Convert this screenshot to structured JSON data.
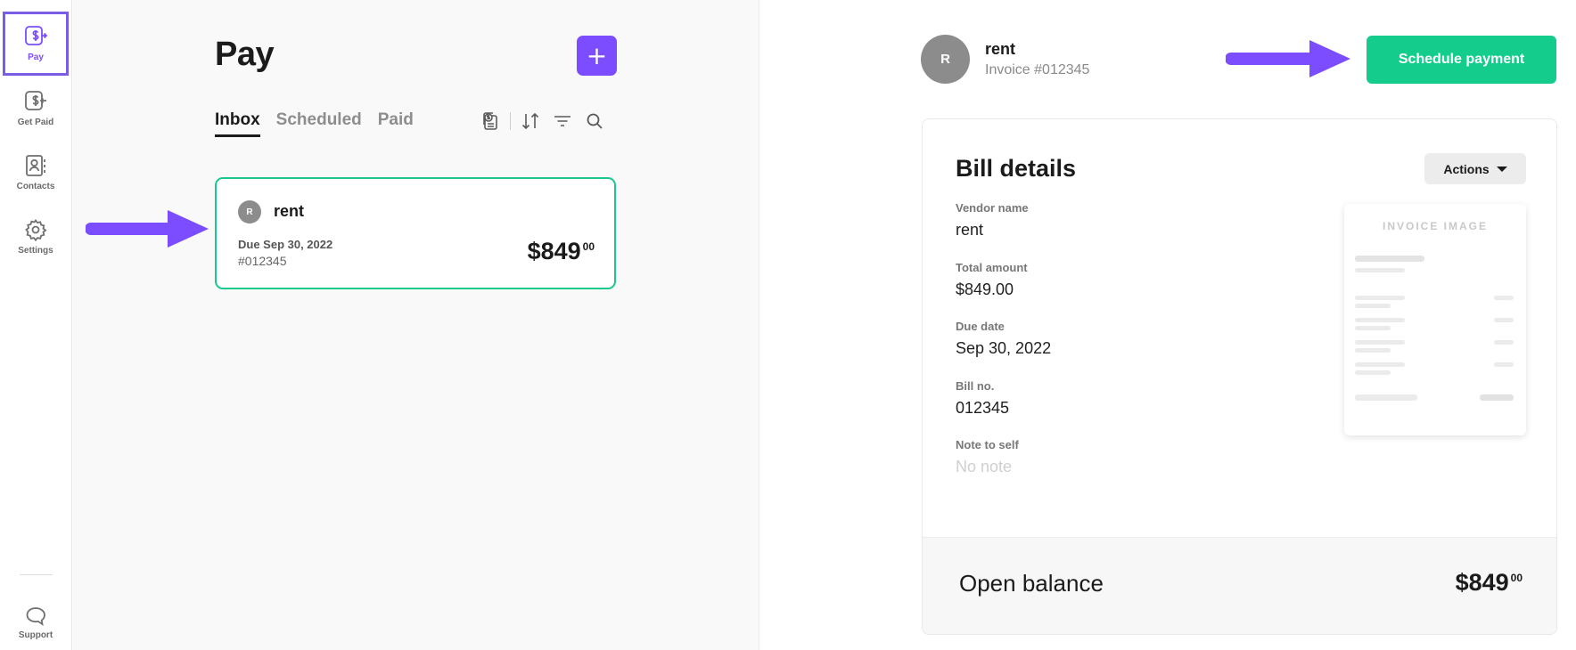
{
  "sidebar": {
    "items": [
      {
        "label": "Pay",
        "icon": "pay-icon",
        "active": true
      },
      {
        "label": "Get Paid",
        "icon": "get-paid-icon"
      },
      {
        "label": "Contacts",
        "icon": "contacts-icon"
      },
      {
        "label": "Settings",
        "icon": "gear-icon"
      }
    ],
    "support": {
      "label": "Support",
      "icon": "chat-bubble-icon"
    }
  },
  "pay": {
    "title": "Pay",
    "add_label": "+",
    "tabs": [
      {
        "label": "Inbox",
        "active": true
      },
      {
        "label": "Scheduled"
      },
      {
        "label": "Paid"
      }
    ],
    "tools": [
      "upload-bill-icon",
      "sort-icon",
      "filter-icon",
      "search-icon"
    ],
    "bills": [
      {
        "avatar": "R",
        "vendor": "rent",
        "due": "Due Sep 30, 2022",
        "number": "#012345",
        "amount": "$849",
        "cents": "00"
      }
    ]
  },
  "detail": {
    "avatar": "R",
    "vendor": "rent",
    "invoice": "Invoice #012345",
    "schedule_label": "Schedule payment",
    "card_title": "Bill details",
    "actions_label": "Actions",
    "fields": [
      {
        "label": "Vendor name",
        "value": "rent"
      },
      {
        "label": "Total amount",
        "value": "$849.00"
      },
      {
        "label": "Due date",
        "value": "Sep 30, 2022"
      },
      {
        "label": "Bill no.",
        "value": "012345"
      },
      {
        "label": "Note to self",
        "value": "No note"
      }
    ],
    "invoice_image_label": "INVOICE IMAGE",
    "balance_label": "Open balance",
    "balance_amount": "$849",
    "balance_cents": "00"
  },
  "colors": {
    "accent": "#7b4dff",
    "success": "#14cc8c",
    "annotation_arrow": "#7b4dff"
  }
}
